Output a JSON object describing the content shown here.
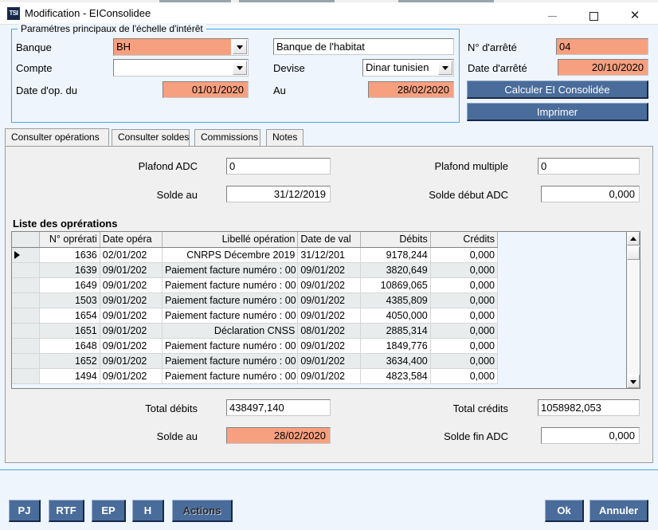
{
  "window": {
    "title": "Modification - EIConsolidee",
    "app_icon": "TSI",
    "minimize_label": "Minimize",
    "maximize_label": "Maximize",
    "close_label": "Close"
  },
  "params": {
    "legend": "Paramétres principaux de l'échelle d'intérêt",
    "banque_label": "Banque",
    "banque_value": "BH",
    "banque_name_value": "Banque de l'habitat",
    "compte_label": "Compte",
    "compte_value": "",
    "devise_label": "Devise",
    "devise_value": "Dinar tunisien",
    "date_op_du_label": "Date d'op. du",
    "date_op_du_value": "01/01/2020",
    "au_label": "Au",
    "au_value": "28/02/2020",
    "num_arrete_label": "N° d'arrêté",
    "num_arrete_value": "04",
    "date_arrete_label": "Date d'arrêté",
    "date_arrete_value": "20/10/2020",
    "calculer_label": "Calculer EI Consolidée",
    "imprimer_label": "Imprimer"
  },
  "tabs": [
    {
      "label": "Consulter opérations",
      "active": true
    },
    {
      "label": "Consulter soldes",
      "active": false
    },
    {
      "label": "Commissions",
      "active": false
    },
    {
      "label": "Notes",
      "active": false
    }
  ],
  "filters": {
    "plafond_adc_label": "Plafond ADC",
    "plafond_adc_value": "0",
    "solde_au_label": "Solde au",
    "solde_au_value": "31/12/2019",
    "plafond_multiple_label": "Plafond multiple",
    "plafond_multiple_value": "0",
    "solde_debut_adc_label": "Solde début ADC",
    "solde_debut_adc_value": "0,000"
  },
  "grid": {
    "title": "Liste des oprérations",
    "columns": [
      "",
      "N° oprérati",
      "Date opéra",
      "Libellé opération",
      "Date de val",
      "Débits",
      "Crédits"
    ],
    "rows": [
      {
        "mark": true,
        "num": "1636",
        "date_op": "02/01/202",
        "libelle": "CNRPS Décembre 2019",
        "date_val": "31/12/201",
        "debit": "9178,244",
        "credit": "0,000"
      },
      {
        "mark": false,
        "num": "1639",
        "date_op": "09/01/202",
        "libelle": "Paiement facture numéro : 00",
        "date_val": "09/01/202",
        "debit": "3820,649",
        "credit": "0,000"
      },
      {
        "mark": false,
        "num": "1649",
        "date_op": "09/01/202",
        "libelle": "Paiement facture numéro : 00",
        "date_val": "09/01/202",
        "debit": "10869,065",
        "credit": "0,000"
      },
      {
        "mark": false,
        "num": "1503",
        "date_op": "09/01/202",
        "libelle": "Paiement facture numéro : 00",
        "date_val": "09/01/202",
        "debit": "4385,809",
        "credit": "0,000"
      },
      {
        "mark": false,
        "num": "1654",
        "date_op": "09/01/202",
        "libelle": "Paiement facture numéro : 00",
        "date_val": "09/01/202",
        "debit": "4050,000",
        "credit": "0,000"
      },
      {
        "mark": false,
        "num": "1651",
        "date_op": "09/01/202",
        "libelle": "Déclaration CNSS",
        "date_val": "08/01/202",
        "debit": "2885,314",
        "credit": "0,000"
      },
      {
        "mark": false,
        "num": "1648",
        "date_op": "09/01/202",
        "libelle": "Paiement facture numéro : 00",
        "date_val": "09/01/202",
        "debit": "1849,776",
        "credit": "0,000"
      },
      {
        "mark": false,
        "num": "1652",
        "date_op": "09/01/202",
        "libelle": "Paiement facture numéro : 00",
        "date_val": "09/01/202",
        "debit": "3634,400",
        "credit": "0,000"
      },
      {
        "mark": false,
        "num": "1494",
        "date_op": "09/01/202",
        "libelle": "Paiement facture numéro : 00",
        "date_val": "09/01/202",
        "debit": "4823,584",
        "credit": "0,000"
      }
    ]
  },
  "totals": {
    "total_debits_label": "Total débits",
    "total_debits_value": "438497,140",
    "solde_au_label": "Solde au",
    "solde_au_value": "28/02/2020",
    "total_credits_label": "Total crédits",
    "total_credits_value": "1058982,053",
    "solde_fin_adc_label": "Solde fin ADC",
    "solde_fin_adc_value": "0,000"
  },
  "toolbar": {
    "pj_label": "PJ",
    "rtf_label": "RTF",
    "ep_label": "EP",
    "h_label": "H",
    "actions_label": "Actions",
    "ok_label": "Ok",
    "annuler_label": "Annuler"
  },
  "colors": {
    "accent_blue": "#4a6c9b",
    "highlight_orange": "#f7a080",
    "panel_bg": "#eef5fd",
    "tabpage_bg": "#f0f0f0",
    "border_blue": "#49a6e0"
  }
}
